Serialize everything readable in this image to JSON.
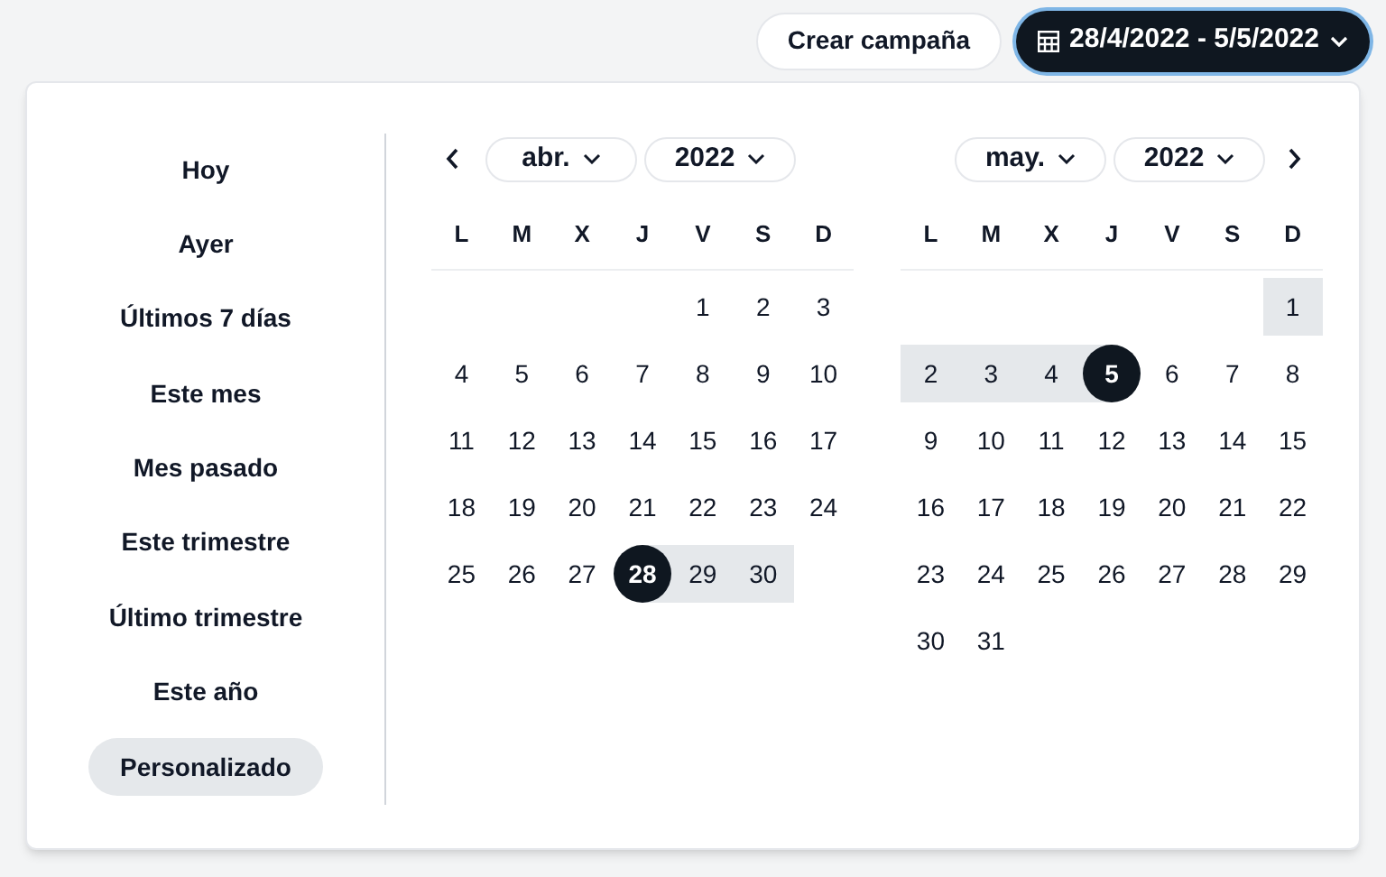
{
  "toolbar": {
    "create_button": "Crear campaña",
    "date_button": "28/4/2022 - 5/5/2022"
  },
  "presets": [
    {
      "label": "Hoy",
      "selected": false
    },
    {
      "label": "Ayer",
      "selected": false
    },
    {
      "label": "Últimos 7 días",
      "selected": false
    },
    {
      "label": "Este mes",
      "selected": false
    },
    {
      "label": "Mes pasado",
      "selected": false
    },
    {
      "label": "Este trimestre",
      "selected": false
    },
    {
      "label": "Último trimestre",
      "selected": false
    },
    {
      "label": "Este año",
      "selected": false
    },
    {
      "label": "Personalizado",
      "selected": true
    }
  ],
  "calendars": [
    {
      "month": "abr.",
      "year": "2022",
      "prev_button": true,
      "next_button": false,
      "weekdays": [
        "L",
        "M",
        "X",
        "J",
        "V",
        "S",
        "D"
      ],
      "weeks": [
        {
          "starts_mid_week": true,
          "days": [
            {
              "day": "1",
              "range_start": false,
              "range_end": false,
              "in_range": false
            },
            {
              "day": "2",
              "range_start": false,
              "range_end": false,
              "in_range": false
            },
            {
              "day": "3",
              "range_start": false,
              "range_end": false,
              "in_range": false
            }
          ]
        },
        {
          "days": [
            {
              "day": "4",
              "range_start": false,
              "range_end": false,
              "in_range": false
            },
            {
              "day": "5",
              "range_start": false,
              "range_end": false,
              "in_range": false
            },
            {
              "day": "6",
              "range_start": false,
              "range_end": false,
              "in_range": false
            },
            {
              "day": "7",
              "range_start": false,
              "range_end": false,
              "in_range": false
            },
            {
              "day": "8",
              "range_start": false,
              "range_end": false,
              "in_range": false
            },
            {
              "day": "9",
              "range_start": false,
              "range_end": false,
              "in_range": false
            },
            {
              "day": "10",
              "range_start": false,
              "range_end": false,
              "in_range": false
            }
          ]
        },
        {
          "days": [
            {
              "day": "11",
              "range_start": false,
              "range_end": false,
              "in_range": false
            },
            {
              "day": "12",
              "range_start": false,
              "range_end": false,
              "in_range": false
            },
            {
              "day": "13",
              "range_start": false,
              "range_end": false,
              "in_range": false
            },
            {
              "day": "14",
              "range_start": false,
              "range_end": false,
              "in_range": false
            },
            {
              "day": "15",
              "range_start": false,
              "range_end": false,
              "in_range": false
            },
            {
              "day": "16",
              "range_start": false,
              "range_end": false,
              "in_range": false
            },
            {
              "day": "17",
              "range_start": false,
              "range_end": false,
              "in_range": false
            }
          ]
        },
        {
          "days": [
            {
              "day": "18",
              "range_start": false,
              "range_end": false,
              "in_range": false
            },
            {
              "day": "19",
              "range_start": false,
              "range_end": false,
              "in_range": false
            },
            {
              "day": "20",
              "range_start": false,
              "range_end": false,
              "in_range": false
            },
            {
              "day": "21",
              "range_start": false,
              "range_end": false,
              "in_range": false
            },
            {
              "day": "22",
              "range_start": false,
              "range_end": false,
              "in_range": false
            },
            {
              "day": "23",
              "range_start": false,
              "range_end": false,
              "in_range": false
            },
            {
              "day": "24",
              "range_start": false,
              "range_end": false,
              "in_range": false
            }
          ]
        },
        {
          "starts_mid_week": false,
          "days": [
            {
              "day": "25",
              "range_start": false,
              "range_end": false,
              "in_range": false
            },
            {
              "day": "26",
              "range_start": false,
              "range_end": false,
              "in_range": false
            },
            {
              "day": "27",
              "range_start": false,
              "range_end": false,
              "in_range": false
            },
            {
              "day": "28",
              "range_start": true,
              "range_end": false
            },
            {
              "day": "29",
              "range_start": false,
              "range_end": false,
              "in_range": true
            },
            {
              "day": "30",
              "range_start": false,
              "range_end": false,
              "in_range": true
            }
          ]
        }
      ]
    },
    {
      "month": "may.",
      "year": "2022",
      "prev_button": false,
      "next_button": true,
      "weekdays": [
        "L",
        "M",
        "X",
        "J",
        "V",
        "S",
        "D"
      ],
      "weeks": [
        {
          "starts_mid_week": true,
          "days": [
            {
              "day": "1",
              "range_start": false,
              "range_end": false,
              "in_range": true
            }
          ]
        },
        {
          "days": [
            {
              "day": "2",
              "range_start": false,
              "range_end": false,
              "in_range": true
            },
            {
              "day": "3",
              "range_start": false,
              "range_end": false,
              "in_range": true
            },
            {
              "day": "4",
              "range_start": false,
              "range_end": false,
              "in_range": true
            },
            {
              "day": "5",
              "range_start": false,
              "range_end": true
            },
            {
              "day": "6",
              "range_start": false,
              "range_end": false,
              "in_range": false
            },
            {
              "day": "7",
              "range_start": false,
              "range_end": false,
              "in_range": false
            },
            {
              "day": "8",
              "range_start": false,
              "range_end": false,
              "in_range": false
            }
          ]
        },
        {
          "days": [
            {
              "day": "9",
              "range_start": false,
              "range_end": false,
              "in_range": false
            },
            {
              "day": "10",
              "range_start": false,
              "range_end": false,
              "in_range": false
            },
            {
              "day": "11",
              "range_start": false,
              "range_end": false,
              "in_range": false
            },
            {
              "day": "12",
              "range_start": false,
              "range_end": false,
              "in_range": false
            },
            {
              "day": "13",
              "range_start": false,
              "range_end": false,
              "in_range": false
            },
            {
              "day": "14",
              "range_start": false,
              "range_end": false,
              "in_range": false
            },
            {
              "day": "15",
              "range_start": false,
              "range_end": false,
              "in_range": false
            }
          ]
        },
        {
          "days": [
            {
              "day": "16",
              "range_start": false,
              "range_end": false,
              "in_range": false
            },
            {
              "day": "17",
              "range_start": false,
              "range_end": false,
              "in_range": false
            },
            {
              "day": "18",
              "range_start": false,
              "range_end": false,
              "in_range": false
            },
            {
              "day": "19",
              "range_start": false,
              "range_end": false,
              "in_range": false
            },
            {
              "day": "20",
              "range_start": false,
              "range_end": false,
              "in_range": false
            },
            {
              "day": "21",
              "range_start": false,
              "range_end": false,
              "in_range": false
            },
            {
              "day": "22",
              "range_start": false,
              "range_end": false,
              "in_range": false
            }
          ]
        },
        {
          "days": [
            {
              "day": "23",
              "range_start": false,
              "range_end": false,
              "in_range": false
            },
            {
              "day": "24",
              "range_start": false,
              "range_end": false,
              "in_range": false
            },
            {
              "day": "25",
              "range_start": false,
              "range_end": false,
              "in_range": false
            },
            {
              "day": "26",
              "range_start": false,
              "range_end": false,
              "in_range": false
            },
            {
              "day": "27",
              "range_start": false,
              "range_end": false,
              "in_range": false
            },
            {
              "day": "28",
              "range_start": false,
              "range_end": false,
              "in_range": false
            },
            {
              "day": "29",
              "range_start": false,
              "range_end": false,
              "in_range": false
            }
          ]
        },
        {
          "starts_mid_week": false,
          "days": [
            {
              "day": "30",
              "range_start": false,
              "range_end": false,
              "in_range": false
            },
            {
              "day": "31",
              "range_start": false,
              "range_end": false,
              "in_range": false
            }
          ]
        }
      ]
    }
  ]
}
